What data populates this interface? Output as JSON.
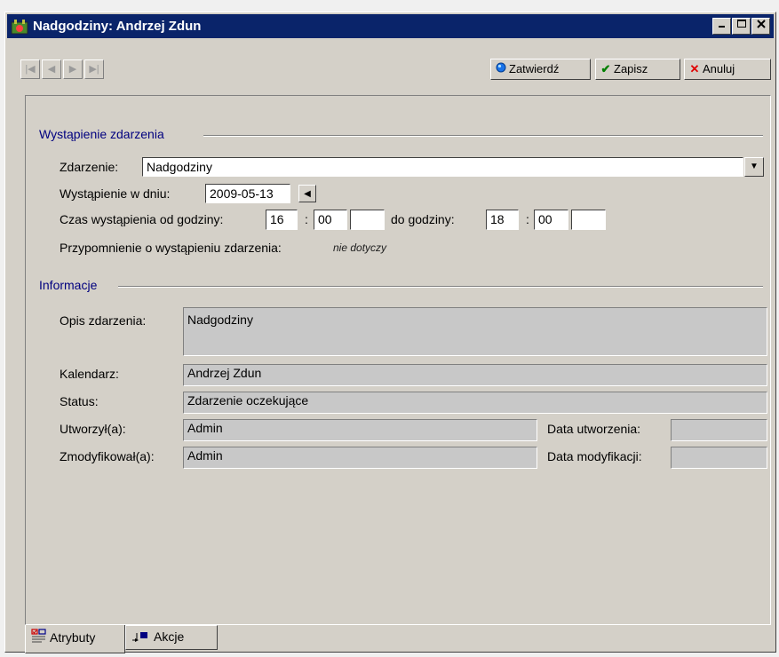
{
  "window": {
    "title": "Nadgodziny: Andrzej Zdun",
    "minimize_icon": "minimize-icon",
    "maximize_icon": "maximize-icon",
    "close_icon": "close-icon"
  },
  "toolbar": {
    "nav": [
      "first-record-icon",
      "previous-record-icon",
      "next-record-icon",
      "last-record-icon"
    ],
    "approve_label": "Zatwierdź",
    "save_label": "Zapisz",
    "cancel_label": "Anuluj"
  },
  "occurrence": {
    "section_title": "Wystąpienie zdarzenia",
    "event_label": "Zdarzenie:",
    "event_value": "Nadgodziny",
    "date_label": "Wystąpienie w dniu:",
    "date_value": "2009-05-13",
    "time_from_label": "Czas wystąpienia od godziny:",
    "time_from_hour": "16",
    "time_from_minute": "00",
    "time_from_extra": "",
    "time_to_label": "do godziny:",
    "time_to_hour": "18",
    "time_to_minute": "00",
    "time_to_extra": "",
    "colon": ":",
    "reminder_label": "Przypomnienie o wystąpieniu zdarzenia:",
    "reminder_value": "nie dotyczy"
  },
  "info": {
    "section_title": "Informacje",
    "description_label": "Opis zdarzenia:",
    "description_value": "Nadgodziny",
    "calendar_label": "Kalendarz:",
    "calendar_value": "Andrzej Zdun",
    "status_label": "Status:",
    "status_value": "Zdarzenie oczekujące",
    "created_by_label": "Utworzył(a):",
    "created_by_value": "Admin",
    "created_date_label": "Data utworzenia:",
    "created_date_value": "",
    "modified_by_label": "Zmodyfikował(a):",
    "modified_by_value": "Admin",
    "modified_date_label": "Data modyfikacji:",
    "modified_date_value": ""
  },
  "tabs": [
    {
      "label": "Atrybuty",
      "icon": "attributes-icon"
    },
    {
      "label": "Akcje",
      "icon": "actions-icon"
    }
  ],
  "colors": {
    "titlebar": "#0a246a",
    "section_text": "#00007f",
    "approve_icon": "#1a73e8",
    "save_icon": "#008000",
    "cancel_icon": "#e00000"
  }
}
